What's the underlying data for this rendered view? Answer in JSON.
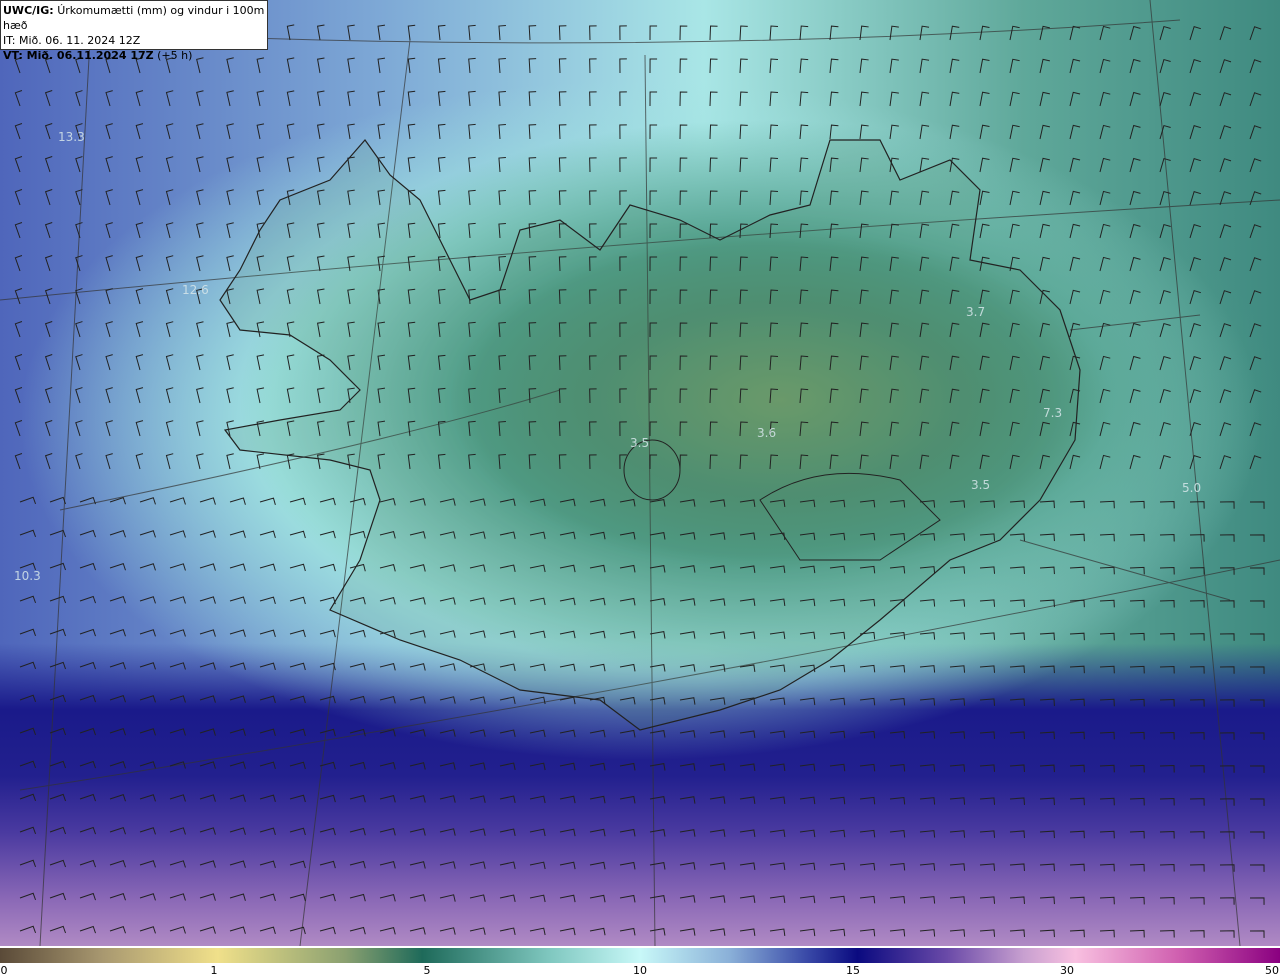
{
  "header": {
    "product": "UWC/IG:",
    "title": "Úrkomumætti (mm) og vindur i 100m hæð",
    "init_time": "IT: Mið. 06. 11. 2024 12Z",
    "valid_label": "VT: Mið. 06.11.2024 17Z",
    "valid_offset": "(+5 h)"
  },
  "value_labels": [
    "13.3",
    "12.6",
    "10.3",
    "3.5",
    "3.6",
    "3.7",
    "7.3",
    "3.5",
    "5.0"
  ],
  "colorbar": {
    "ticks": [
      "0",
      "1",
      "5",
      "10",
      "15",
      "30",
      "50"
    ],
    "unit": "mm"
  }
}
